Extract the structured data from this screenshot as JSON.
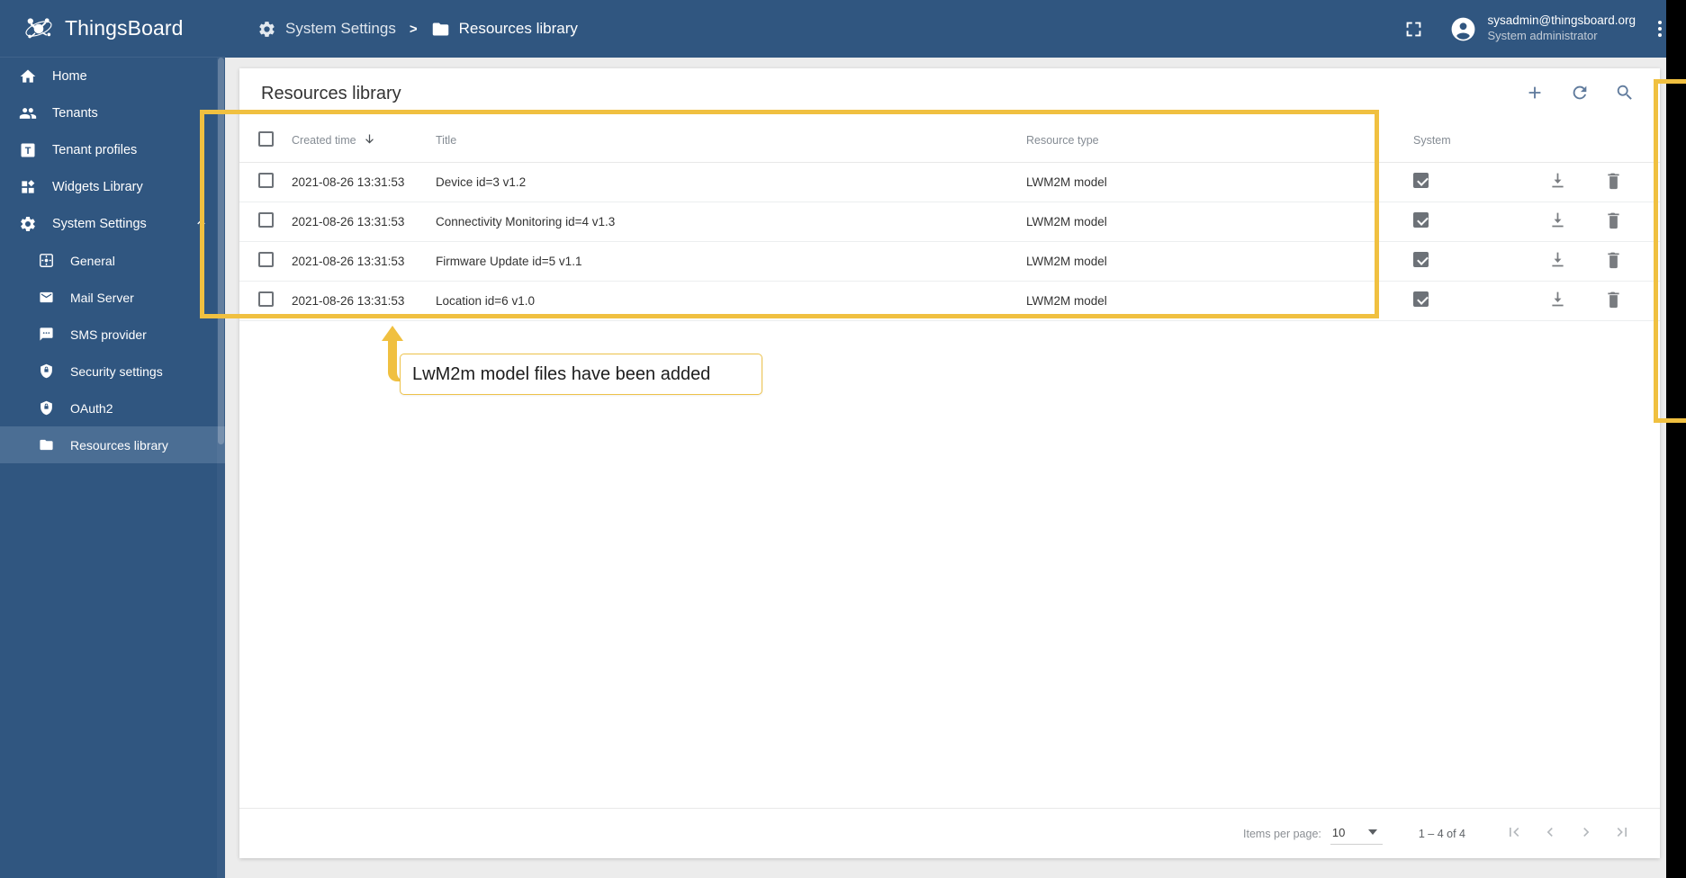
{
  "app": {
    "brand": "ThingsBoard",
    "logo_icon": "thingsboard-logo-icon"
  },
  "sidebar": {
    "items": [
      {
        "label": "Home",
        "icon": "home-icon",
        "level": "top",
        "active": false
      },
      {
        "label": "Tenants",
        "icon": "people-icon",
        "level": "top",
        "active": false
      },
      {
        "label": "Tenant profiles",
        "icon": "tenant-profile-icon",
        "level": "top",
        "active": false
      },
      {
        "label": "Widgets Library",
        "icon": "widgets-icon",
        "level": "top",
        "active": false
      },
      {
        "label": "System Settings",
        "icon": "gear-icon",
        "level": "top",
        "active": false,
        "expander": "chevron-up-icon"
      },
      {
        "label": "General",
        "icon": "general-settings-icon",
        "level": "sub",
        "active": false
      },
      {
        "label": "Mail Server",
        "icon": "mail-icon",
        "level": "sub",
        "active": false
      },
      {
        "label": "SMS provider",
        "icon": "sms-icon",
        "level": "sub",
        "active": false
      },
      {
        "label": "Security settings",
        "icon": "shield-icon",
        "level": "sub",
        "active": false
      },
      {
        "label": "OAuth2",
        "icon": "shield-icon",
        "level": "sub",
        "active": false
      },
      {
        "label": "Resources library",
        "icon": "folder-icon",
        "level": "sub",
        "active": true
      }
    ]
  },
  "topbar": {
    "breadcrumb": {
      "parent": "System Settings",
      "parent_icon": "gear-icon",
      "separator": ">",
      "current": "Resources library",
      "current_icon": "folder-icon"
    },
    "fullscreen_icon": "fullscreen-icon",
    "avatar_icon": "account-circle-icon",
    "user_email": "sysadmin@thingsboard.org",
    "user_role": "System administrator",
    "menu_icon": "more-vertical-icon"
  },
  "card": {
    "title": "Resources library",
    "actions": [
      {
        "name": "add-resource-button",
        "icon": "plus-icon"
      },
      {
        "name": "refresh-button",
        "icon": "refresh-icon"
      },
      {
        "name": "search-button",
        "icon": "search-icon"
      }
    ]
  },
  "table": {
    "columns": [
      {
        "key": "select",
        "label": ""
      },
      {
        "key": "created",
        "label": "Created time",
        "sort": "desc",
        "sort_icon": "arrow-down-icon"
      },
      {
        "key": "title",
        "label": "Title"
      },
      {
        "key": "type",
        "label": "Resource type"
      },
      {
        "key": "system",
        "label": "System"
      }
    ],
    "rows": [
      {
        "created": "2021-08-26 13:31:53",
        "title": "Device id=3 v1.2",
        "type": "LWM2M model",
        "system": true,
        "selected": false
      },
      {
        "created": "2021-08-26 13:31:53",
        "title": "Connectivity Monitoring id=4 v1.3",
        "type": "LWM2M model",
        "system": true,
        "selected": false
      },
      {
        "created": "2021-08-26 13:31:53",
        "title": "Firmware Update id=5 v1.1",
        "type": "LWM2M model",
        "system": true,
        "selected": false
      },
      {
        "created": "2021-08-26 13:31:53",
        "title": "Location id=6 v1.0",
        "type": "LWM2M model",
        "system": true,
        "selected": false
      }
    ],
    "row_actions": [
      {
        "name": "download-resource-button",
        "icon": "download-icon"
      },
      {
        "name": "delete-resource-button",
        "icon": "trash-icon"
      }
    ]
  },
  "paginator": {
    "items_per_page_label": "Items per page:",
    "items_per_page_value": "10",
    "range_label": "1 – 4 of 4",
    "buttons": [
      {
        "name": "first-page-button",
        "icon": "first-page-icon"
      },
      {
        "name": "previous-page-button",
        "icon": "chevron-left-icon"
      },
      {
        "name": "next-page-button",
        "icon": "chevron-right-icon"
      },
      {
        "name": "last-page-button",
        "icon": "last-page-icon"
      }
    ]
  },
  "annotation": {
    "callout_text": "LwM2m model files have been added",
    "highlight_color": "#f0c040",
    "arrow_icon": "up-arrow-annotation-icon"
  }
}
